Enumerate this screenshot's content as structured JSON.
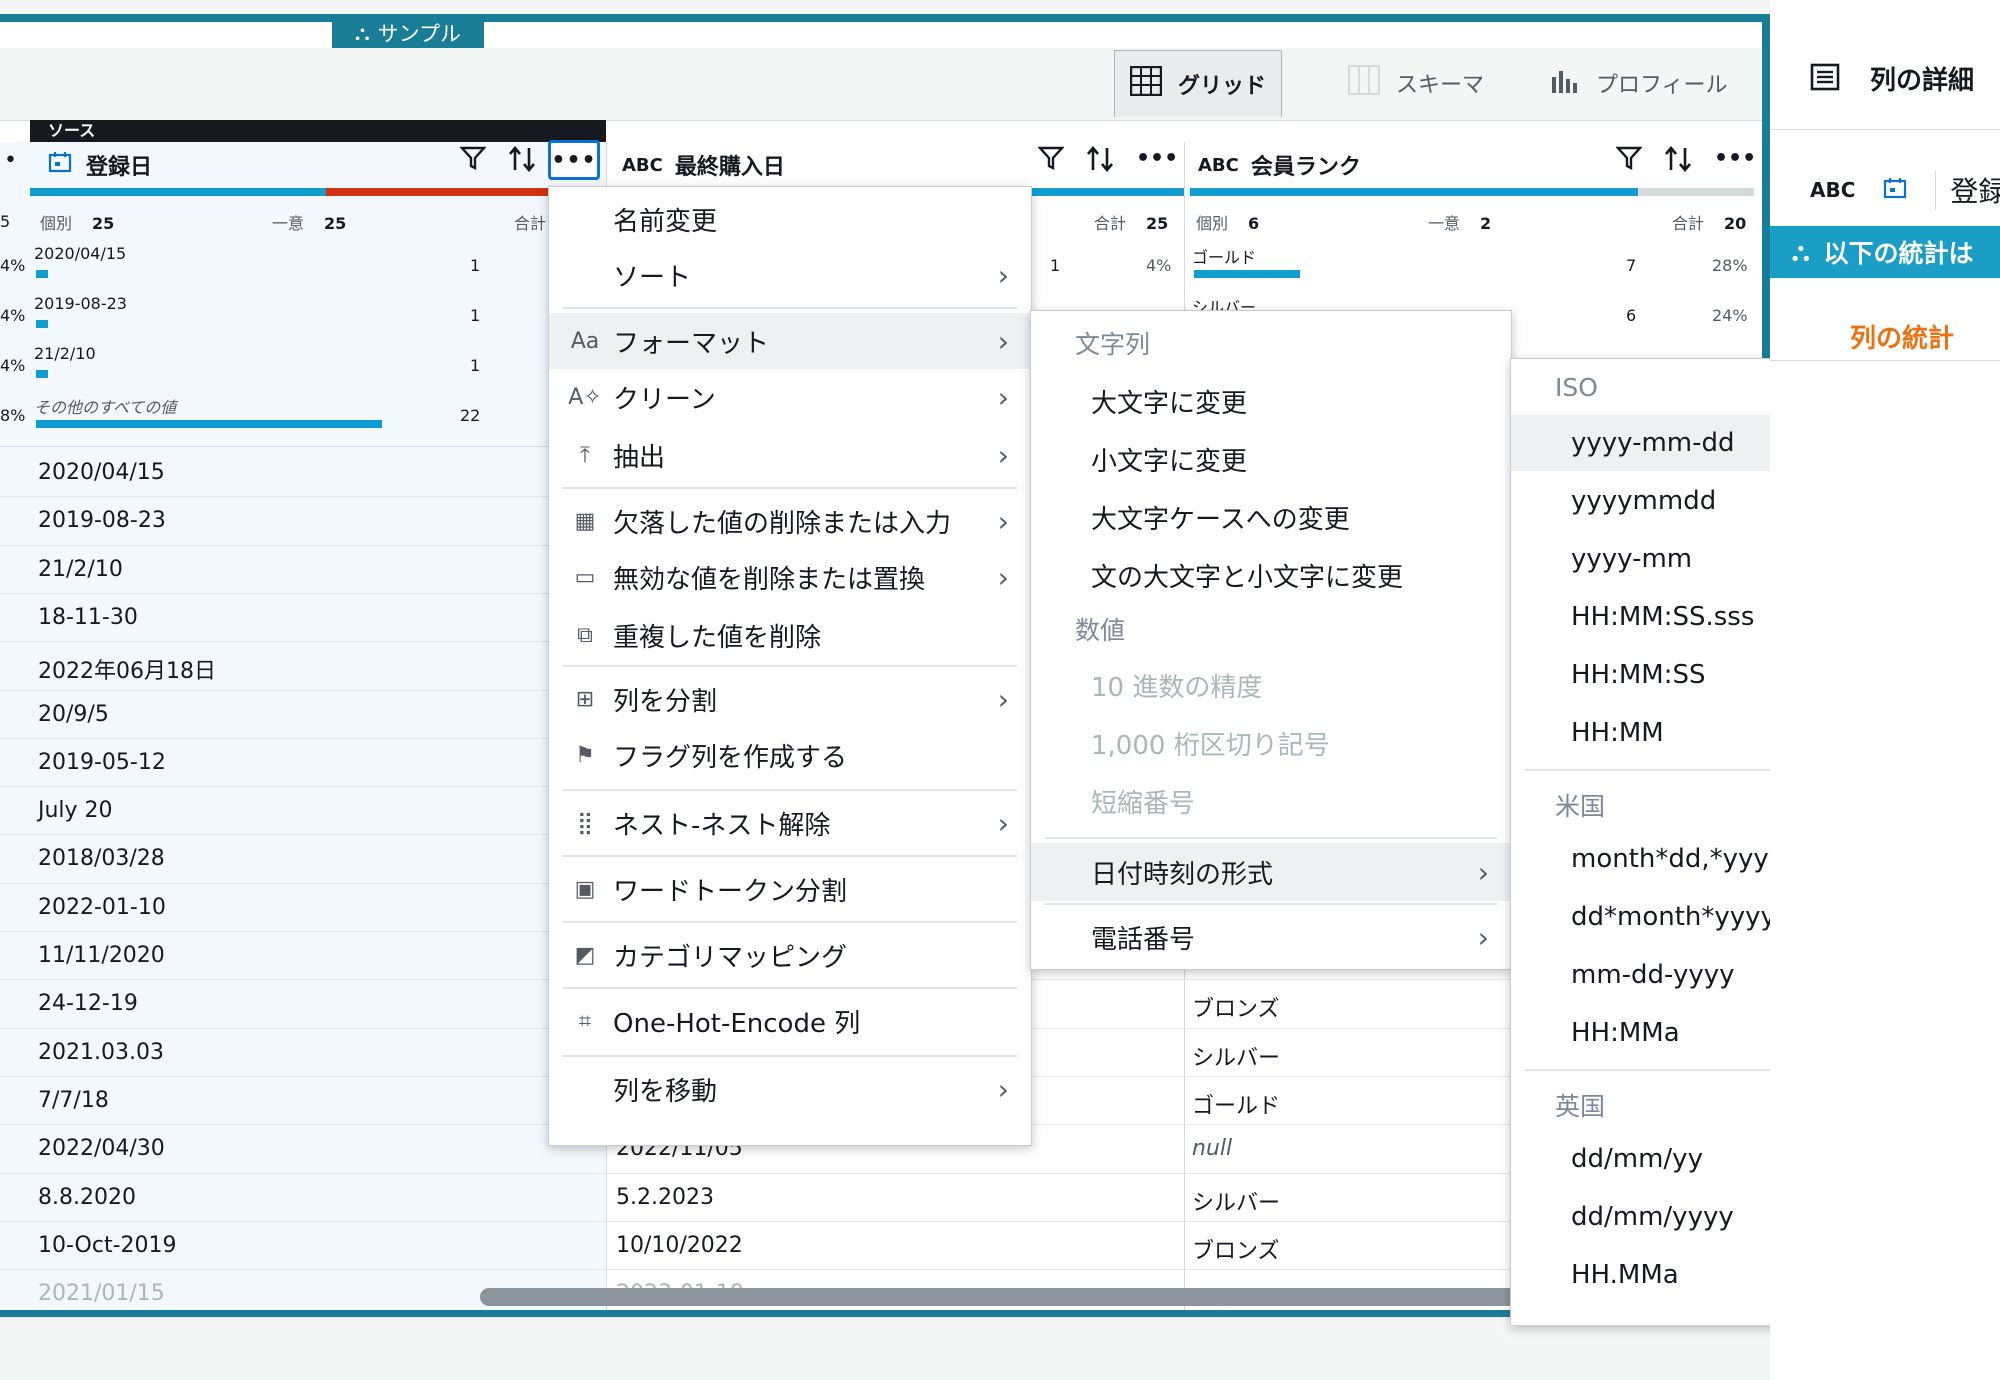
{
  "sample_tag": "サンプル",
  "views": {
    "grid": "グリッド",
    "schema": "スキーマ",
    "profile": "プロフィール"
  },
  "source_label": "ソース",
  "columns": {
    "col1": {
      "type": "",
      "name": "登録日",
      "distinct_label": "個別",
      "distinct": "25",
      "unique_label": "一意",
      "unique": "25",
      "total_label": "合計"
    },
    "col2": {
      "type": "ABC",
      "name": "最終購入日",
      "total_label": "合計",
      "total": "25",
      "count": "1",
      "pct": "4%"
    },
    "col3": {
      "type": "ABC",
      "name": "会員ランク",
      "distinct_label": "個別",
      "distinct": "6",
      "unique_label": "一意",
      "unique": "2",
      "total_label": "合計",
      "total": "20"
    }
  },
  "left_partial": {
    "top": "5",
    "pcts": [
      "4%",
      "4%",
      "4%",
      "8%"
    ]
  },
  "col1_stats": [
    {
      "label": "2020/04/15",
      "count": "1"
    },
    {
      "label": "2019-08-23",
      "count": "1"
    },
    {
      "label": "21/2/10",
      "count": "1"
    },
    {
      "label": "その他のすべての値",
      "count": "22"
    }
  ],
  "col3_stats": [
    {
      "label": "ゴールド",
      "count": "7",
      "pct": "28%"
    },
    {
      "label": "シルバー",
      "count": "6",
      "pct": "24%"
    }
  ],
  "col1_values": [
    "2020/04/15",
    "2019-08-23",
    "21/2/10",
    "18-11-30",
    "2022年06月18日",
    "20/9/5",
    "2019-05-12",
    "July 20",
    "2018/03/28",
    "2022-01-10",
    "11/11/2020",
    "24-12-19",
    "2021.03.03",
    "7/7/18",
    "2022/04/30",
    "8.8.2020",
    "10-Oct-2019",
    "2021/01/15"
  ],
  "col2_values_visible": [
    {
      "row": 14,
      "value": "2022/11/05"
    },
    {
      "row": 15,
      "value": "5.2.2023"
    },
    {
      "row": 16,
      "value": "10/10/2022"
    },
    {
      "row": 17,
      "value": "2023-01-18"
    }
  ],
  "col3_values_visible": [
    {
      "row": 11,
      "value": "ブロンズ"
    },
    {
      "row": 12,
      "value": "シルバー"
    },
    {
      "row": 13,
      "value": "ゴールド"
    },
    {
      "row": 14,
      "value": "null"
    },
    {
      "row": 15,
      "value": "シルバー"
    },
    {
      "row": 16,
      "value": "ブロンズ"
    },
    {
      "row": 17,
      "value": "シルバー"
    }
  ],
  "menu_main": {
    "items": [
      {
        "label": "名前変更",
        "icon": "",
        "chevron": false
      },
      {
        "label": "ソート",
        "icon": "",
        "chevron": true
      },
      {
        "label": "フォーマット",
        "icon": "Aa",
        "chevron": true
      },
      {
        "label": "クリーン",
        "icon": "A✧",
        "chevron": true
      },
      {
        "label": "抽出",
        "icon": "⤒",
        "chevron": true
      },
      {
        "label": "欠落した値の削除または入力",
        "icon": "▦",
        "chevron": true
      },
      {
        "label": "無効な値を削除または置換",
        "icon": "▭",
        "chevron": true
      },
      {
        "label": "重複した値を削除",
        "icon": "⧉",
        "chevron": false
      },
      {
        "label": "列を分割",
        "icon": "⊞",
        "chevron": true
      },
      {
        "label": "フラグ列を作成する",
        "icon": "⚑",
        "chevron": false
      },
      {
        "label": "ネスト-ネスト解除",
        "icon": "⣿",
        "chevron": true
      },
      {
        "label": "ワードトークン分割",
        "icon": "▣",
        "chevron": false
      },
      {
        "label": "カテゴリマッピング",
        "icon": "◩",
        "chevron": false
      },
      {
        "label": "One-Hot-Encode 列",
        "icon": "⌗",
        "chevron": false
      },
      {
        "label": "列を移動",
        "icon": "",
        "chevron": true
      }
    ]
  },
  "menu_format": {
    "string_header": "文字列",
    "string_items": [
      "大文字に変更",
      "小文字に変更",
      "大文字ケースへの変更",
      "文の大文字と小文字に変更"
    ],
    "number_header": "数値",
    "number_items": [
      "10 進数の精度",
      "1,000 桁区切り記号",
      "短縮番号"
    ],
    "datetime": "日付時刻の形式",
    "phone": "電話番号"
  },
  "menu_datetime": {
    "iso_header": "ISO",
    "iso_items": [
      "yyyy-mm-dd",
      "yyyymmdd",
      "yyyy-mm",
      "HH:MM:SS.sss",
      "HH:MM:SS",
      "HH:MM"
    ],
    "us_header": "米国",
    "us_items": [
      "month*dd,*yyyy",
      "dd*month*yyyy",
      "mm-dd-yyyy",
      "HH:MMa"
    ],
    "uk_header": "英国",
    "uk_items": [
      "dd/mm/yy",
      "dd/mm/yyyy",
      "HH.MMa"
    ]
  },
  "right_panel": {
    "title": "列の詳細",
    "type": "ABC",
    "col_name": "登録",
    "stats_banner": "以下の統計は",
    "stats_tab": "列の統計"
  },
  "colors": {
    "accent": "#1a7d98",
    "bar_blue": "#0f9ecf",
    "bar_red": "#d13212",
    "orange": "#ec7211"
  }
}
